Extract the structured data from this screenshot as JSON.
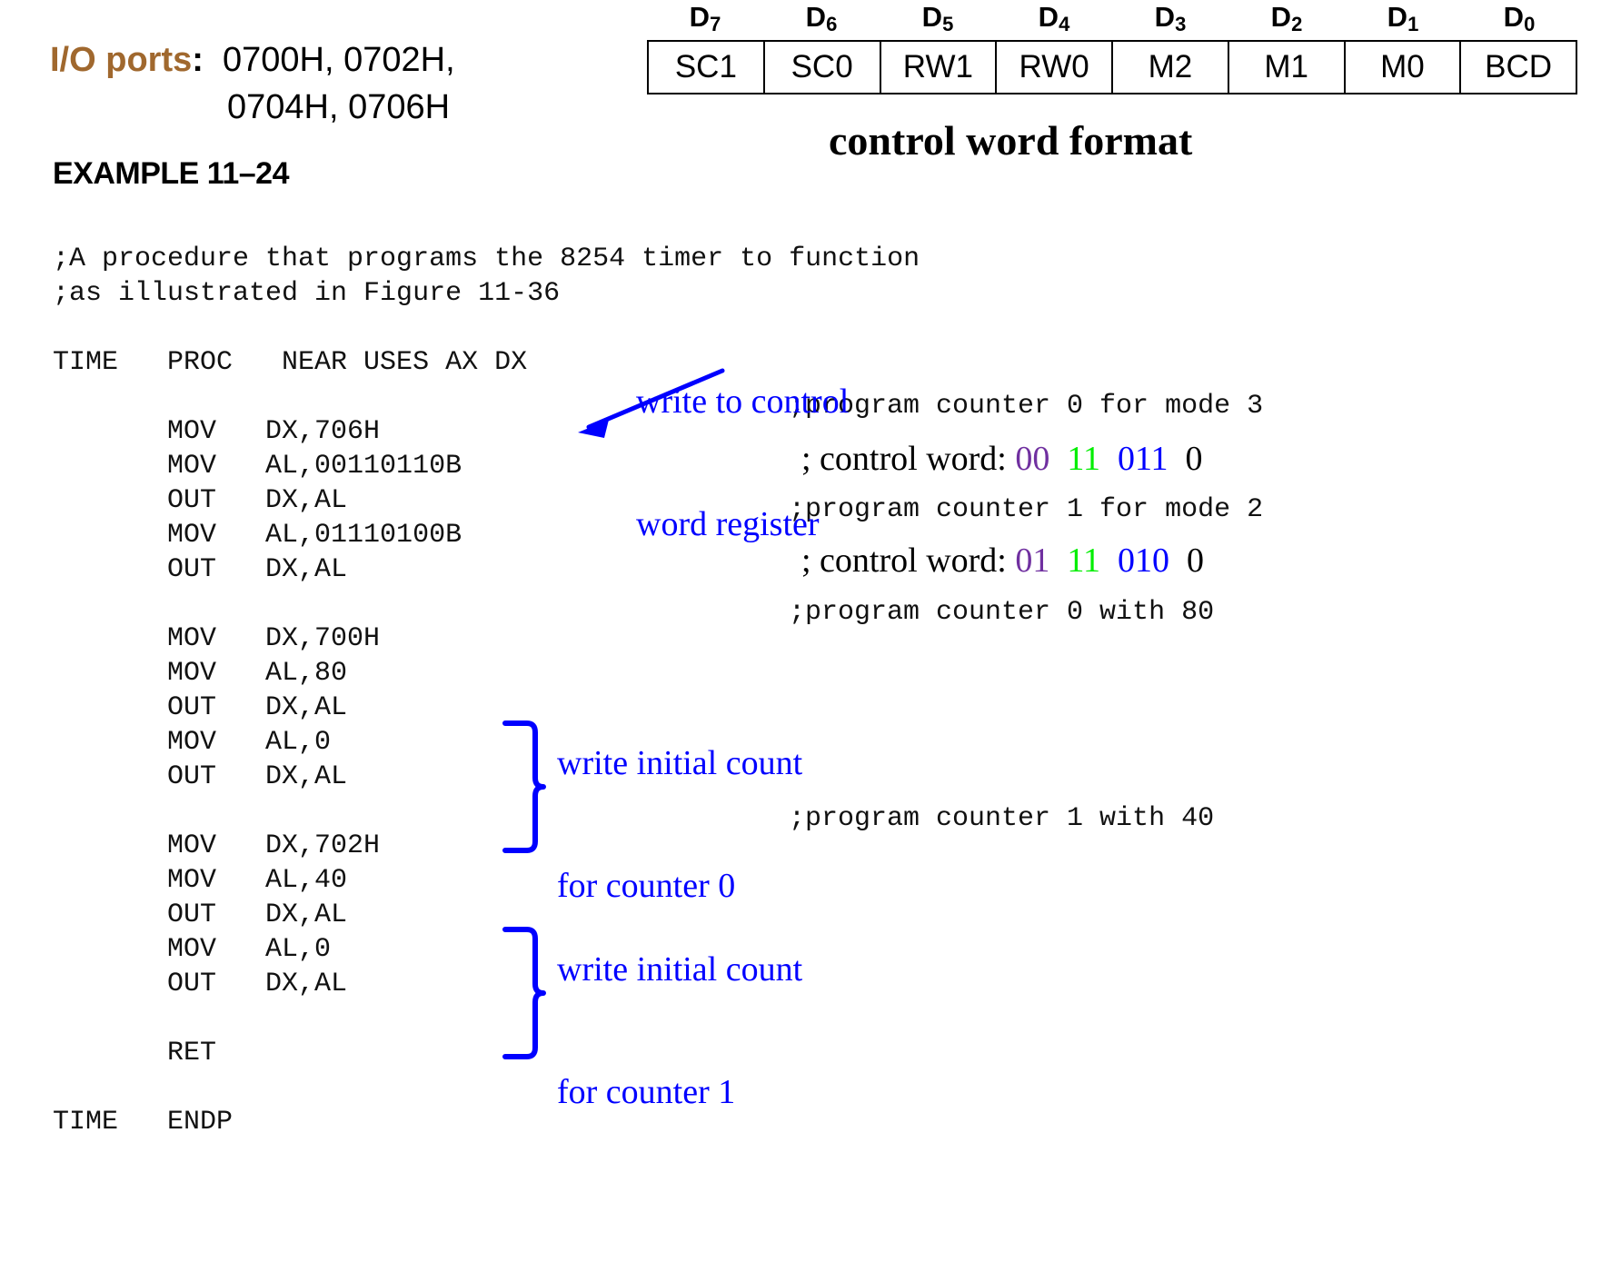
{
  "io_ports": {
    "label": "I/O ports",
    "colon": ":",
    "line1": "0700H, 0702H,",
    "line2": "0704H, 0706H",
    "label_color": "#a0682e"
  },
  "control_word_table": {
    "bit_labels": [
      "D7",
      "D6",
      "D5",
      "D4",
      "D3",
      "D2",
      "D1",
      "D0"
    ],
    "bit_label_base": [
      "D",
      "D",
      "D",
      "D",
      "D",
      "D",
      "D",
      "D"
    ],
    "bit_label_sub": [
      "7",
      "6",
      "5",
      "4",
      "3",
      "2",
      "1",
      "0"
    ],
    "cells": [
      "SC1",
      "SC0",
      "RW1",
      "RW0",
      "M2",
      "M1",
      "M0",
      "BCD"
    ],
    "title": "control word format"
  },
  "example": {
    "heading": "EXAMPLE 11–24",
    "code": ";A procedure that programs the 8254 timer to function\n;as illustrated in Figure 11-36\n\nTIME   PROC   NEAR USES AX DX\n\n       MOV   DX,706H\n       MOV   AL,00110110B\n       OUT   DX,AL\n       MOV   AL,01110100B\n       OUT   DX,AL\n\n       MOV   DX,700H\n       MOV   AL,80\n       OUT   DX,AL\n       MOV   AL,0\n       OUT   DX,AL\n\n       MOV   DX,702H\n       MOV   AL,40\n       OUT   DX,AL\n       MOV   AL,0\n       OUT   DX,AL\n\n       RET\n\nTIME   ENDP"
  },
  "comments": {
    "counter0_mode3": ";program counter 0 for mode 3",
    "counter1_mode2": ";program counter 1 for mode 2",
    "counter0_with80": ";program counter 0 with 80",
    "counter1_with40": ";program counter 1 with 40"
  },
  "control_words": {
    "line1": {
      "prefix": "; control word: ",
      "sc": "00",
      "rw": "11",
      "mode": "011",
      "bcd": "0"
    },
    "line2": {
      "prefix": "; control word: ",
      "sc": "01",
      "rw": "11",
      "mode": "010",
      "bcd": "0"
    },
    "colors": {
      "sc": "#7030a0",
      "rw": "#00ee00",
      "mode": "#0000ff",
      "bcd": "#000000"
    }
  },
  "annotations": {
    "write_control_word": {
      "line1": "write to control",
      "line2": "word register"
    },
    "counter0_brace": {
      "line1": "write initial count",
      "line2": "for counter 0"
    },
    "counter1_brace": {
      "line1": "write initial count",
      "line2": "for counter 1"
    },
    "color": "#0000ff"
  }
}
